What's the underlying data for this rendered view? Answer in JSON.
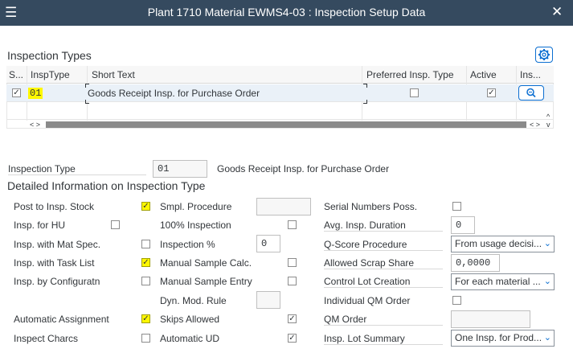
{
  "window": {
    "title": "Plant 1710 Material EWMS4-03 : Inspection Setup Data",
    "menu_icon": "hamburger-icon",
    "close_icon": "close-icon"
  },
  "inspection_types": {
    "heading": "Inspection Types",
    "settings_icon": "gear-icon",
    "columns": [
      "S...",
      "InspType",
      "Short Text",
      "Preferred Insp. Type",
      "Active",
      "Ins..."
    ],
    "rows": [
      {
        "selected": true,
        "insp_type": "01",
        "short_text": "Goods Receipt Insp. for Purchase Order",
        "preferred": false,
        "active": true,
        "details_icon": "magnifier-icon"
      }
    ],
    "scroll_left": "< >",
    "scroll_right": "< >",
    "scroll_up": "^",
    "scroll_down": "v"
  },
  "detail": {
    "inspection_type_label": "Inspection Type",
    "inspection_type_value": "01",
    "inspection_type_text": "Goods Receipt Insp. for Purchase Order",
    "heading": "Detailed Information on Inspection Type",
    "col1": [
      {
        "label": "Post to Insp. Stock",
        "checked": true,
        "highlighted": true
      },
      {
        "label": "Insp. for HU",
        "checked": false,
        "highlighted": false
      },
      {
        "label": "Insp. with Mat Spec.",
        "checked": false,
        "highlighted": false
      },
      {
        "label": "Insp. with Task List",
        "checked": true,
        "highlighted": true
      },
      {
        "label": "Insp. by Configuratn",
        "checked": false,
        "highlighted": false
      },
      {
        "label": "Automatic Assignment",
        "checked": true,
        "highlighted": true
      },
      {
        "label": "Inspect Charcs",
        "checked": false,
        "highlighted": false
      }
    ],
    "col2": {
      "smpl_procedure": {
        "label": "Smpl. Procedure",
        "value": ""
      },
      "hundred_pct": {
        "label": "100% Inspection",
        "checked": false
      },
      "insp_pct": {
        "label": "Inspection %",
        "value": "0"
      },
      "manual_sample_calc": {
        "label": "Manual Sample Calc.",
        "checked": false
      },
      "manual_sample_entry": {
        "label": "Manual Sample Entry",
        "checked": false
      },
      "dyn_mod_rule": {
        "label": "Dyn. Mod. Rule",
        "value": ""
      },
      "skips_allowed": {
        "label": "Skips Allowed",
        "checked": true
      },
      "automatic_ud": {
        "label": "Automatic UD",
        "checked": true
      }
    },
    "col3": {
      "serial_numbers": {
        "label": "Serial Numbers Poss.",
        "checked": false
      },
      "avg_duration": {
        "label": "Avg. Insp. Duration",
        "value": "0"
      },
      "qscore": {
        "label": "Q-Score Procedure",
        "value": "From usage decisi..."
      },
      "scrap_share": {
        "label": "Allowed Scrap Share",
        "value": "0,0000"
      },
      "control_lot": {
        "label": "Control Lot Creation",
        "value": "For each material ..."
      },
      "individual_qm": {
        "label": "Individual QM Order",
        "checked": false
      },
      "qm_order": {
        "label": "QM Order",
        "value": ""
      },
      "lot_summary": {
        "label": "Insp. Lot Summary",
        "value": "One Insp. for Prod..."
      }
    },
    "check_mark": "✓",
    "dropdown_icon": "chevron-down-icon"
  },
  "colors": {
    "titlebar": "#354a5f",
    "accent": "#0a6ed1",
    "highlight": "#fff700"
  }
}
